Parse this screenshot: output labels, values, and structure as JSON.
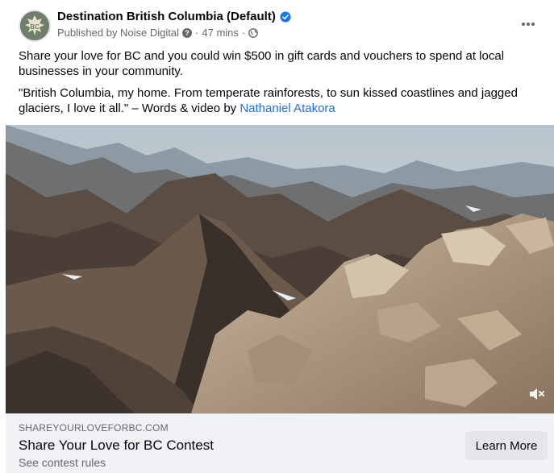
{
  "header": {
    "page_name": "Destination British Columbia (Default)",
    "published_by": "Published by Noise Digital",
    "time": "47 mins",
    "avatar_text": "BC",
    "more_icon": "more-options-icon"
  },
  "post": {
    "paragraph1": "Share your love for BC and you could win $500 in gift cards and vouchers to spend at local businesses in your community.",
    "paragraph2_prefix": "\"British Columbia, my home. From temperate rainforests, to sun kissed coastlines and jagged glaciers, I love it all.\" – Words & video by ",
    "paragraph2_link": "Nathaniel Atakora"
  },
  "video": {
    "description": "mountain-landscape-video",
    "mute_icon": "speaker-muted-icon"
  },
  "link_preview": {
    "domain": "SHAREYOURLOVEFORBC.COM",
    "title": "Share Your Love for BC Contest",
    "description": "See contest rules",
    "cta_label": "Learn More"
  },
  "colors": {
    "link": "#216fdb",
    "verified": "#1877f2",
    "footer_bg": "#f0f2f5",
    "button_bg": "#e4e6eb"
  }
}
